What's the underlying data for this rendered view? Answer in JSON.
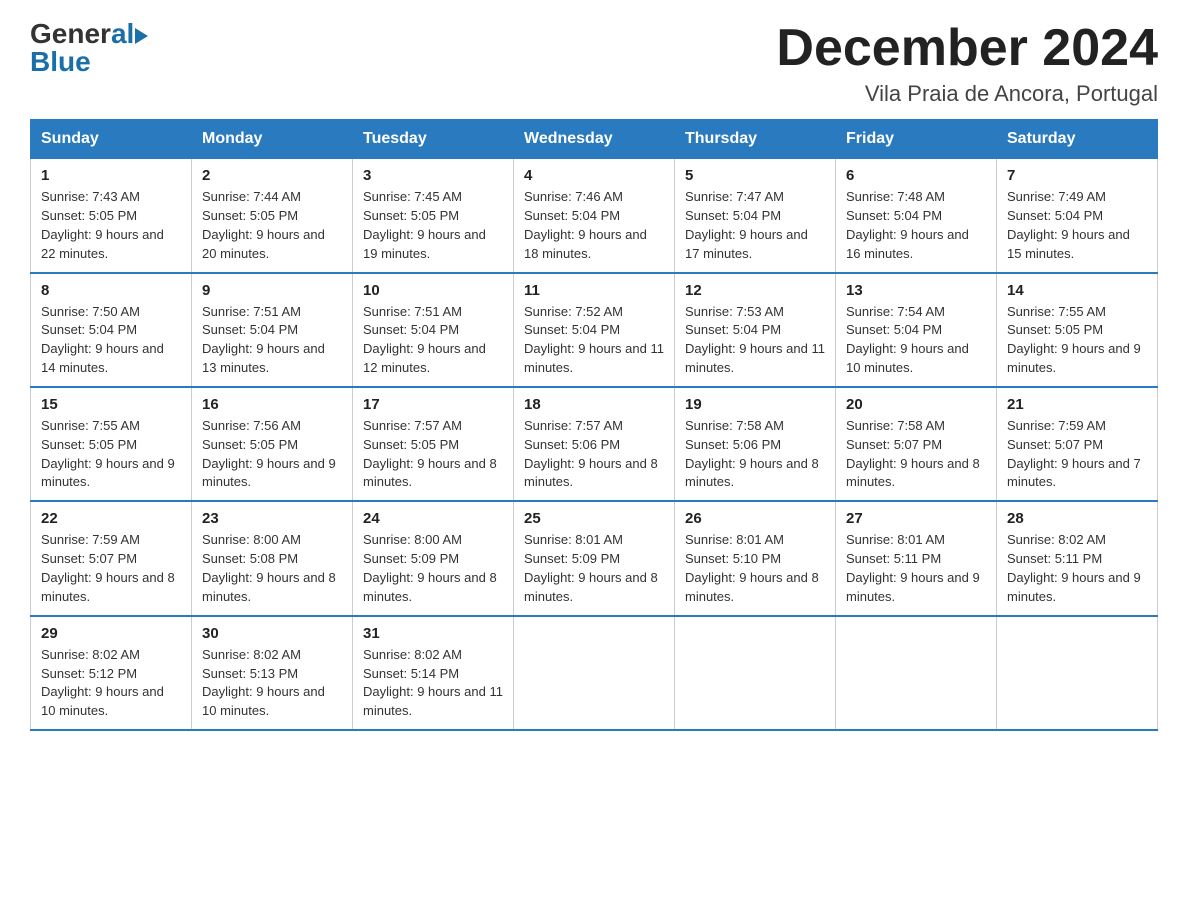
{
  "logo": {
    "general": "General",
    "blue": "Blue",
    "arrow": "▶"
  },
  "title": "December 2024",
  "subtitle": "Vila Praia de Ancora, Portugal",
  "headers": [
    "Sunday",
    "Monday",
    "Tuesday",
    "Wednesday",
    "Thursday",
    "Friday",
    "Saturday"
  ],
  "weeks": [
    [
      {
        "day": "1",
        "sunrise": "7:43 AM",
        "sunset": "5:05 PM",
        "daylight": "9 hours and 22 minutes."
      },
      {
        "day": "2",
        "sunrise": "7:44 AM",
        "sunset": "5:05 PM",
        "daylight": "9 hours and 20 minutes."
      },
      {
        "day": "3",
        "sunrise": "7:45 AM",
        "sunset": "5:05 PM",
        "daylight": "9 hours and 19 minutes."
      },
      {
        "day": "4",
        "sunrise": "7:46 AM",
        "sunset": "5:04 PM",
        "daylight": "9 hours and 18 minutes."
      },
      {
        "day": "5",
        "sunrise": "7:47 AM",
        "sunset": "5:04 PM",
        "daylight": "9 hours and 17 minutes."
      },
      {
        "day": "6",
        "sunrise": "7:48 AM",
        "sunset": "5:04 PM",
        "daylight": "9 hours and 16 minutes."
      },
      {
        "day": "7",
        "sunrise": "7:49 AM",
        "sunset": "5:04 PM",
        "daylight": "9 hours and 15 minutes."
      }
    ],
    [
      {
        "day": "8",
        "sunrise": "7:50 AM",
        "sunset": "5:04 PM",
        "daylight": "9 hours and 14 minutes."
      },
      {
        "day": "9",
        "sunrise": "7:51 AM",
        "sunset": "5:04 PM",
        "daylight": "9 hours and 13 minutes."
      },
      {
        "day": "10",
        "sunrise": "7:51 AM",
        "sunset": "5:04 PM",
        "daylight": "9 hours and 12 minutes."
      },
      {
        "day": "11",
        "sunrise": "7:52 AM",
        "sunset": "5:04 PM",
        "daylight": "9 hours and 11 minutes."
      },
      {
        "day": "12",
        "sunrise": "7:53 AM",
        "sunset": "5:04 PM",
        "daylight": "9 hours and 11 minutes."
      },
      {
        "day": "13",
        "sunrise": "7:54 AM",
        "sunset": "5:04 PM",
        "daylight": "9 hours and 10 minutes."
      },
      {
        "day": "14",
        "sunrise": "7:55 AM",
        "sunset": "5:05 PM",
        "daylight": "9 hours and 9 minutes."
      }
    ],
    [
      {
        "day": "15",
        "sunrise": "7:55 AM",
        "sunset": "5:05 PM",
        "daylight": "9 hours and 9 minutes."
      },
      {
        "day": "16",
        "sunrise": "7:56 AM",
        "sunset": "5:05 PM",
        "daylight": "9 hours and 9 minutes."
      },
      {
        "day": "17",
        "sunrise": "7:57 AM",
        "sunset": "5:05 PM",
        "daylight": "9 hours and 8 minutes."
      },
      {
        "day": "18",
        "sunrise": "7:57 AM",
        "sunset": "5:06 PM",
        "daylight": "9 hours and 8 minutes."
      },
      {
        "day": "19",
        "sunrise": "7:58 AM",
        "sunset": "5:06 PM",
        "daylight": "9 hours and 8 minutes."
      },
      {
        "day": "20",
        "sunrise": "7:58 AM",
        "sunset": "5:07 PM",
        "daylight": "9 hours and 8 minutes."
      },
      {
        "day": "21",
        "sunrise": "7:59 AM",
        "sunset": "5:07 PM",
        "daylight": "9 hours and 7 minutes."
      }
    ],
    [
      {
        "day": "22",
        "sunrise": "7:59 AM",
        "sunset": "5:07 PM",
        "daylight": "9 hours and 8 minutes."
      },
      {
        "day": "23",
        "sunrise": "8:00 AM",
        "sunset": "5:08 PM",
        "daylight": "9 hours and 8 minutes."
      },
      {
        "day": "24",
        "sunrise": "8:00 AM",
        "sunset": "5:09 PM",
        "daylight": "9 hours and 8 minutes."
      },
      {
        "day": "25",
        "sunrise": "8:01 AM",
        "sunset": "5:09 PM",
        "daylight": "9 hours and 8 minutes."
      },
      {
        "day": "26",
        "sunrise": "8:01 AM",
        "sunset": "5:10 PM",
        "daylight": "9 hours and 8 minutes."
      },
      {
        "day": "27",
        "sunrise": "8:01 AM",
        "sunset": "5:11 PM",
        "daylight": "9 hours and 9 minutes."
      },
      {
        "day": "28",
        "sunrise": "8:02 AM",
        "sunset": "5:11 PM",
        "daylight": "9 hours and 9 minutes."
      }
    ],
    [
      {
        "day": "29",
        "sunrise": "8:02 AM",
        "sunset": "5:12 PM",
        "daylight": "9 hours and 10 minutes."
      },
      {
        "day": "30",
        "sunrise": "8:02 AM",
        "sunset": "5:13 PM",
        "daylight": "9 hours and 10 minutes."
      },
      {
        "day": "31",
        "sunrise": "8:02 AM",
        "sunset": "5:14 PM",
        "daylight": "9 hours and 11 minutes."
      },
      null,
      null,
      null,
      null
    ]
  ]
}
